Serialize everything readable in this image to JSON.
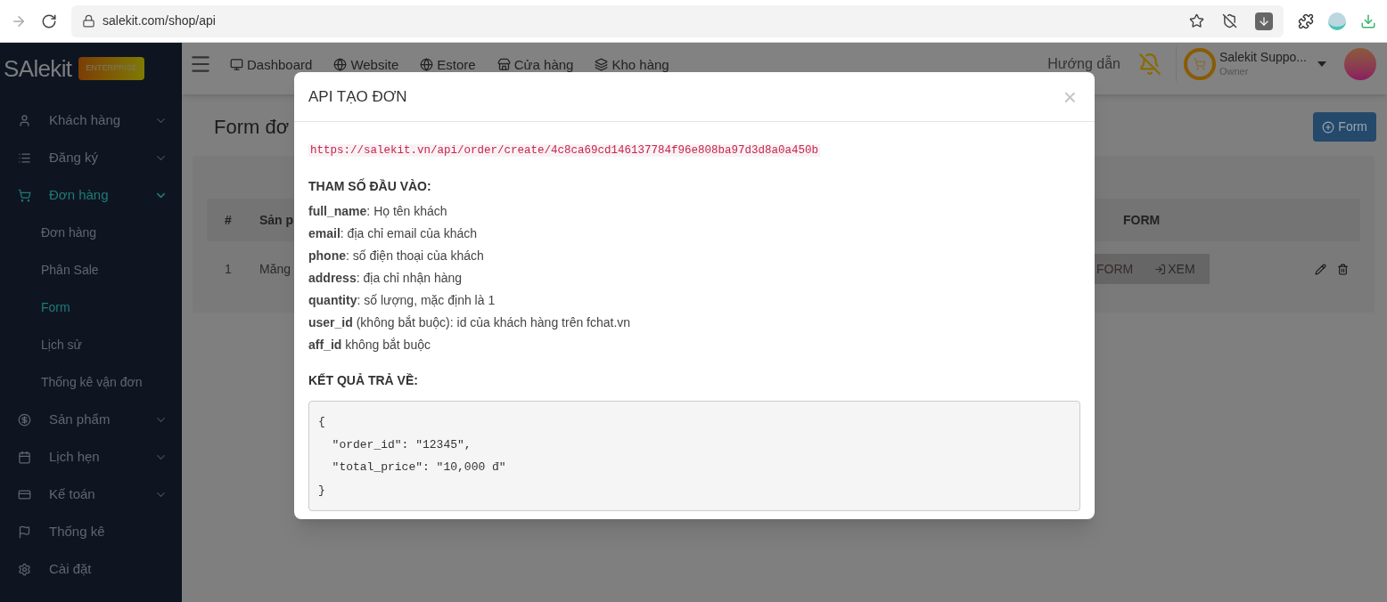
{
  "browser": {
    "url": "salekit.com/shop/api"
  },
  "app": {
    "logo": "SAlekit",
    "plan_badge": "ENTERPRISE",
    "top_nav": [
      "Dashboard",
      "Website",
      "Estore",
      "Cửa hàng",
      "Kho hàng"
    ],
    "help_link": "Hướng dẫn",
    "account": {
      "name": "Salekit Suppo...",
      "role": "Owner"
    }
  },
  "sidebar": {
    "items": [
      {
        "label": "Khách hàng",
        "expanded": false,
        "selected": false
      },
      {
        "label": "Đăng ký",
        "expanded": false,
        "selected": false
      },
      {
        "label": "Đơn hàng",
        "expanded": true,
        "selected": true,
        "children": [
          {
            "label": "Đơn hàng",
            "selected": false
          },
          {
            "label": "Phân Sale",
            "selected": false
          },
          {
            "label": "Form",
            "selected": true
          },
          {
            "label": "Lịch sử",
            "selected": false
          },
          {
            "label": "Thống kê vận đơn",
            "selected": false
          }
        ]
      },
      {
        "label": "Sản phẩm",
        "expanded": false,
        "selected": false
      },
      {
        "label": "Lịch hẹn",
        "expanded": false,
        "selected": false
      },
      {
        "label": "Kế toán",
        "expanded": false,
        "selected": false
      },
      {
        "label": "Thống kê",
        "selected": false
      },
      {
        "label": "Cài đặt",
        "selected": false
      }
    ]
  },
  "page": {
    "title": "Form đơ",
    "add_button": "Form",
    "table": {
      "columns": [
        "#",
        "Sản p",
        "FORM"
      ],
      "rows": [
        {
          "index": "1",
          "product": "Măng",
          "form_button": "FORM",
          "view_button": "XEM"
        }
      ]
    }
  },
  "dialog": {
    "title": "API TẠO ĐƠN",
    "close": "×",
    "endpoint": "https://salekit.vn/api/order/create/4c8ca69cd146137784f96e808ba97d3d8a0a450b",
    "params_heading": "THAM SỐ ĐẦU VÀO:",
    "params": [
      "**full_name**: Họ tên khách",
      "**email**: địa chỉ email của khách",
      "**phone**: số điện thoại của khách",
      "**address**: địa chỉ nhận hàng",
      "**quantity**: số lượng, mặc định là 1",
      "**user_id** (không bắt buộc): id của khách hàng trên fchat.vn",
      "**aff_id** không bắt buộc"
    ],
    "result_heading": "KẾT QUẢ TRẢ VỀ:",
    "result_lines": [
      "{",
      "  \"order_id\": \"12345\",",
      "  \"total_price\": \"10,000 đ\"",
      "}"
    ]
  }
}
